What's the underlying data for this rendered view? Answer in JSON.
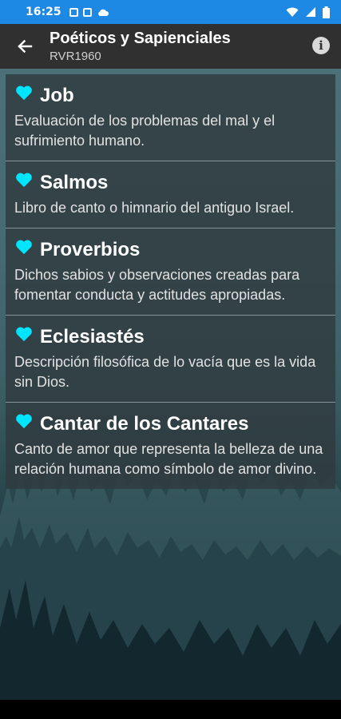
{
  "status_bar": {
    "time": "16:25"
  },
  "appbar": {
    "title": "Poéticos y Sapienciales",
    "subtitle": "RVR1960"
  },
  "books": [
    {
      "name": "Job",
      "description": "Evaluación de los problemas del mal y el sufrimiento humano."
    },
    {
      "name": "Salmos",
      "description": "Libro de canto o himnario del antiguo Israel."
    },
    {
      "name": "Proverbios",
      "description": "Dichos sabios y observaciones creadas para fomentar conducta y actitudes apropiadas."
    },
    {
      "name": "Eclesiastés",
      "description": "Descripción filosófica de lo vacía que es la vida sin Dios."
    },
    {
      "name": "Cantar de los Cantares",
      "description": "Canto de amor que representa la belleza de una relación humana como símbolo de amor divino."
    }
  ],
  "colors": {
    "status_bar": "#1e88e5",
    "appbar": "#303030",
    "heart": "#00e5ff"
  }
}
